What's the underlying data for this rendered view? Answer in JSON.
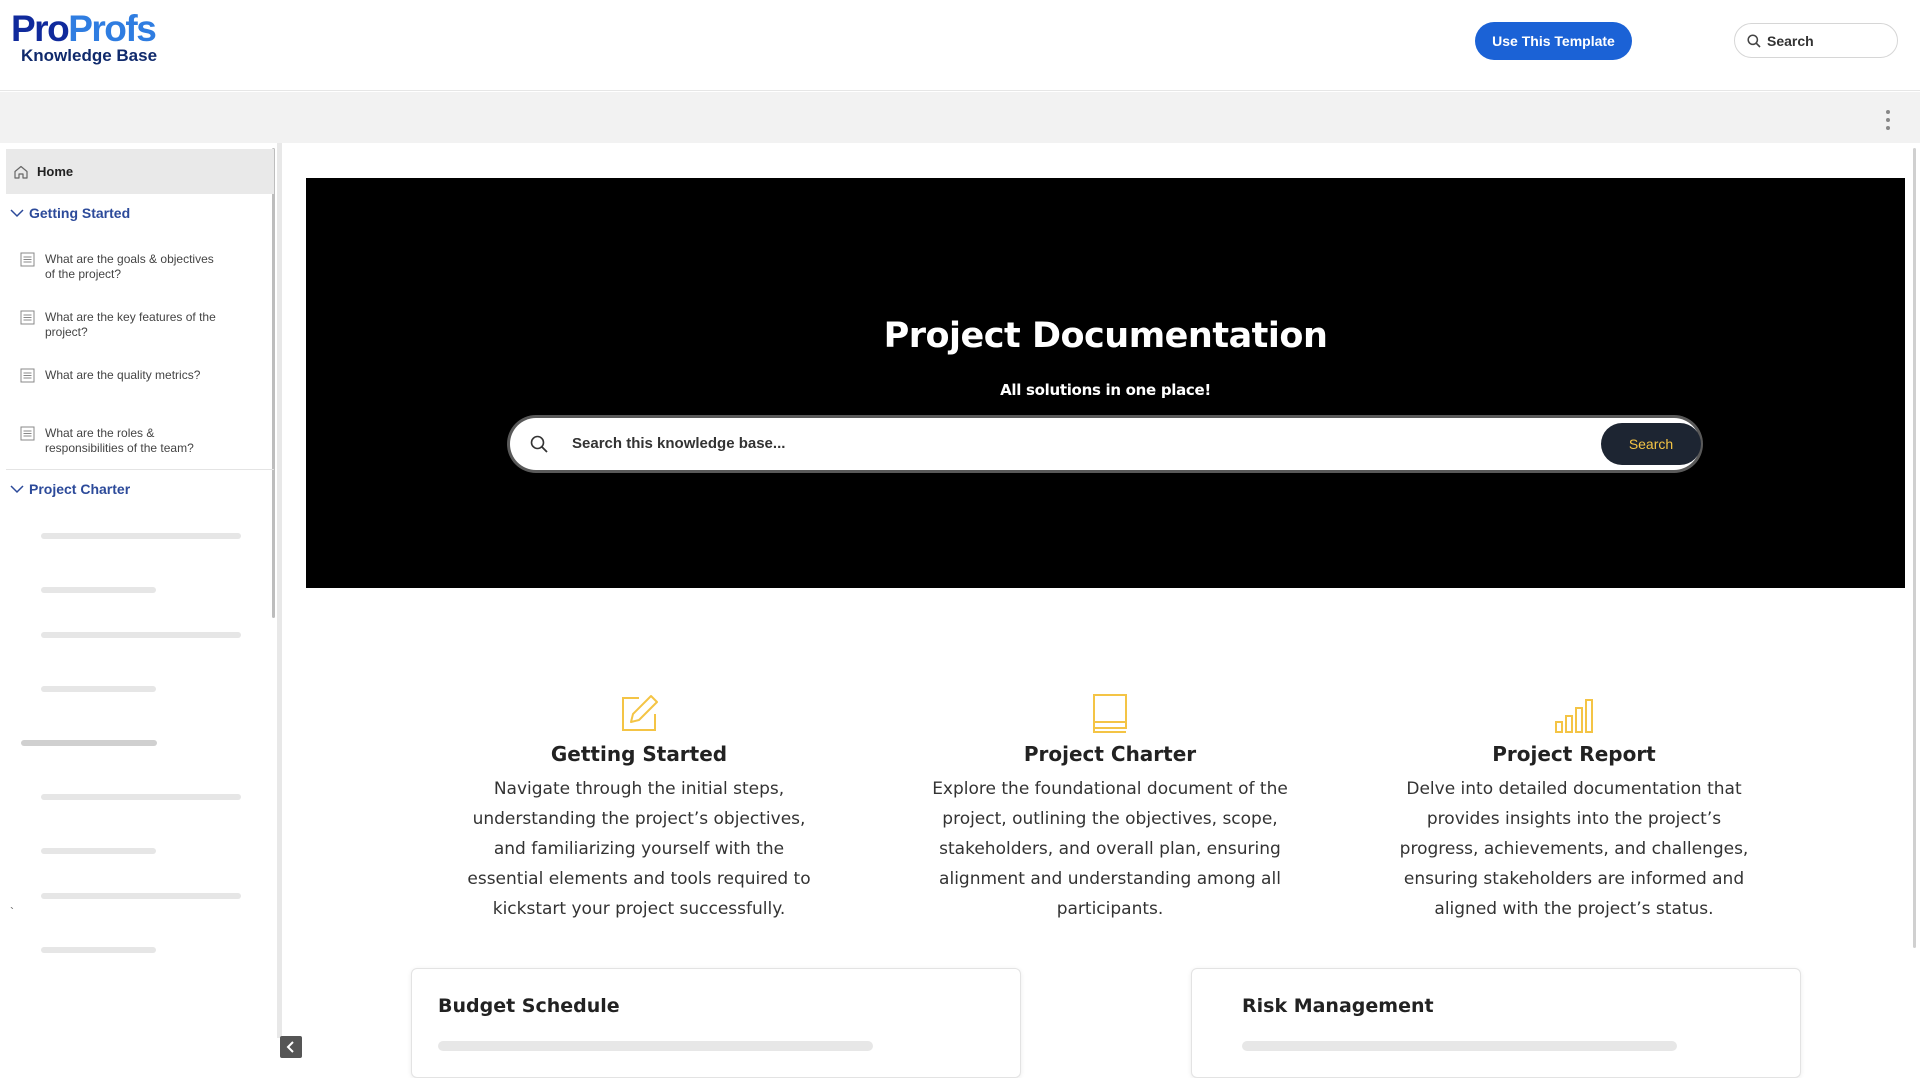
{
  "header": {
    "logo_top_pro": "Pro",
    "logo_top_profs": "Profs",
    "logo_bottom": "Knowledge Base",
    "use_template_label": "Use This Template",
    "search_label": "Search"
  },
  "sidebar": {
    "home_label": "Home",
    "sections": [
      {
        "label": "Getting Started",
        "articles": [
          "What are the goals & objectives of the project?",
          "What are the key features of the project?",
          "What are the quality metrics?",
          "What are the roles & responsibilities of the team?"
        ]
      },
      {
        "label": "Project Charter"
      }
    ],
    "stray_mark": "`"
  },
  "hero": {
    "title": "Project Documentation",
    "subtitle": "All solutions in one place!",
    "search_placeholder": "Search this knowledge base...",
    "search_button": "Search"
  },
  "categories": [
    {
      "icon": "edit-icon",
      "title": "Getting Started",
      "description": "Navigate through the initial steps, understanding the project’s objectives, and familiarizing yourself with the essential elements and tools required to kickstart your project successfully."
    },
    {
      "icon": "book-icon",
      "title": "Project Charter",
      "description": "Explore the foundational document of the project, outlining the objectives, scope, stakeholders, and overall plan, ensuring alignment and understanding among all participants."
    },
    {
      "icon": "bar-chart-icon",
      "title": "Project Report",
      "description": "Delve into detailed documentation that provides insights into the project’s progress, achievements, and challenges, ensuring stakeholders are informed and aligned with the project’s status."
    }
  ],
  "bottom_cards": [
    {
      "title": "Budget Schedule"
    },
    {
      "title": "Risk Management"
    }
  ],
  "colors": {
    "brand_blue": "#1b62d6",
    "accent_yellow": "#f4c445",
    "sidebar_section_blue": "#2c4a9a",
    "hero_bg": "#000000"
  }
}
